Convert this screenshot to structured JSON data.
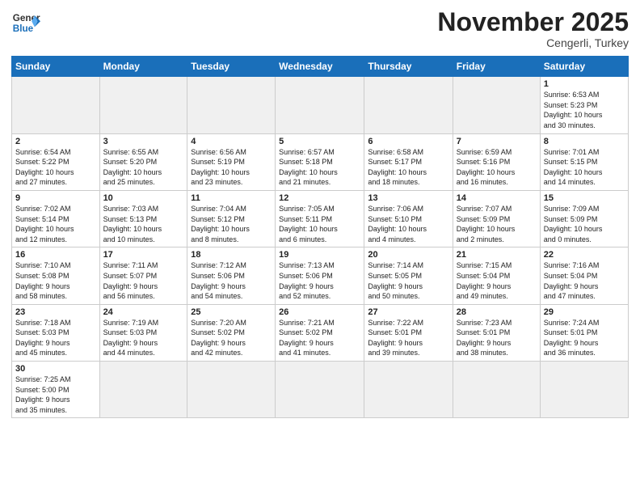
{
  "header": {
    "logo_general": "General",
    "logo_blue": "Blue",
    "month_title": "November 2025",
    "location": "Cengerli, Turkey"
  },
  "weekdays": [
    "Sunday",
    "Monday",
    "Tuesday",
    "Wednesday",
    "Thursday",
    "Friday",
    "Saturday"
  ],
  "weeks": [
    [
      {
        "day": "",
        "info": ""
      },
      {
        "day": "",
        "info": ""
      },
      {
        "day": "",
        "info": ""
      },
      {
        "day": "",
        "info": ""
      },
      {
        "day": "",
        "info": ""
      },
      {
        "day": "",
        "info": ""
      },
      {
        "day": "1",
        "info": "Sunrise: 6:53 AM\nSunset: 5:23 PM\nDaylight: 10 hours\nand 30 minutes."
      }
    ],
    [
      {
        "day": "2",
        "info": "Sunrise: 6:54 AM\nSunset: 5:22 PM\nDaylight: 10 hours\nand 27 minutes."
      },
      {
        "day": "3",
        "info": "Sunrise: 6:55 AM\nSunset: 5:20 PM\nDaylight: 10 hours\nand 25 minutes."
      },
      {
        "day": "4",
        "info": "Sunrise: 6:56 AM\nSunset: 5:19 PM\nDaylight: 10 hours\nand 23 minutes."
      },
      {
        "day": "5",
        "info": "Sunrise: 6:57 AM\nSunset: 5:18 PM\nDaylight: 10 hours\nand 21 minutes."
      },
      {
        "day": "6",
        "info": "Sunrise: 6:58 AM\nSunset: 5:17 PM\nDaylight: 10 hours\nand 18 minutes."
      },
      {
        "day": "7",
        "info": "Sunrise: 6:59 AM\nSunset: 5:16 PM\nDaylight: 10 hours\nand 16 minutes."
      },
      {
        "day": "8",
        "info": "Sunrise: 7:01 AM\nSunset: 5:15 PM\nDaylight: 10 hours\nand 14 minutes."
      }
    ],
    [
      {
        "day": "9",
        "info": "Sunrise: 7:02 AM\nSunset: 5:14 PM\nDaylight: 10 hours\nand 12 minutes."
      },
      {
        "day": "10",
        "info": "Sunrise: 7:03 AM\nSunset: 5:13 PM\nDaylight: 10 hours\nand 10 minutes."
      },
      {
        "day": "11",
        "info": "Sunrise: 7:04 AM\nSunset: 5:12 PM\nDaylight: 10 hours\nand 8 minutes."
      },
      {
        "day": "12",
        "info": "Sunrise: 7:05 AM\nSunset: 5:11 PM\nDaylight: 10 hours\nand 6 minutes."
      },
      {
        "day": "13",
        "info": "Sunrise: 7:06 AM\nSunset: 5:10 PM\nDaylight: 10 hours\nand 4 minutes."
      },
      {
        "day": "14",
        "info": "Sunrise: 7:07 AM\nSunset: 5:09 PM\nDaylight: 10 hours\nand 2 minutes."
      },
      {
        "day": "15",
        "info": "Sunrise: 7:09 AM\nSunset: 5:09 PM\nDaylight: 10 hours\nand 0 minutes."
      }
    ],
    [
      {
        "day": "16",
        "info": "Sunrise: 7:10 AM\nSunset: 5:08 PM\nDaylight: 9 hours\nand 58 minutes."
      },
      {
        "day": "17",
        "info": "Sunrise: 7:11 AM\nSunset: 5:07 PM\nDaylight: 9 hours\nand 56 minutes."
      },
      {
        "day": "18",
        "info": "Sunrise: 7:12 AM\nSunset: 5:06 PM\nDaylight: 9 hours\nand 54 minutes."
      },
      {
        "day": "19",
        "info": "Sunrise: 7:13 AM\nSunset: 5:06 PM\nDaylight: 9 hours\nand 52 minutes."
      },
      {
        "day": "20",
        "info": "Sunrise: 7:14 AM\nSunset: 5:05 PM\nDaylight: 9 hours\nand 50 minutes."
      },
      {
        "day": "21",
        "info": "Sunrise: 7:15 AM\nSunset: 5:04 PM\nDaylight: 9 hours\nand 49 minutes."
      },
      {
        "day": "22",
        "info": "Sunrise: 7:16 AM\nSunset: 5:04 PM\nDaylight: 9 hours\nand 47 minutes."
      }
    ],
    [
      {
        "day": "23",
        "info": "Sunrise: 7:18 AM\nSunset: 5:03 PM\nDaylight: 9 hours\nand 45 minutes."
      },
      {
        "day": "24",
        "info": "Sunrise: 7:19 AM\nSunset: 5:03 PM\nDaylight: 9 hours\nand 44 minutes."
      },
      {
        "day": "25",
        "info": "Sunrise: 7:20 AM\nSunset: 5:02 PM\nDaylight: 9 hours\nand 42 minutes."
      },
      {
        "day": "26",
        "info": "Sunrise: 7:21 AM\nSunset: 5:02 PM\nDaylight: 9 hours\nand 41 minutes."
      },
      {
        "day": "27",
        "info": "Sunrise: 7:22 AM\nSunset: 5:01 PM\nDaylight: 9 hours\nand 39 minutes."
      },
      {
        "day": "28",
        "info": "Sunrise: 7:23 AM\nSunset: 5:01 PM\nDaylight: 9 hours\nand 38 minutes."
      },
      {
        "day": "29",
        "info": "Sunrise: 7:24 AM\nSunset: 5:01 PM\nDaylight: 9 hours\nand 36 minutes."
      }
    ],
    [
      {
        "day": "30",
        "info": "Sunrise: 7:25 AM\nSunset: 5:00 PM\nDaylight: 9 hours\nand 35 minutes."
      },
      {
        "day": "",
        "info": ""
      },
      {
        "day": "",
        "info": ""
      },
      {
        "day": "",
        "info": ""
      },
      {
        "day": "",
        "info": ""
      },
      {
        "day": "",
        "info": ""
      },
      {
        "day": "",
        "info": ""
      }
    ]
  ]
}
